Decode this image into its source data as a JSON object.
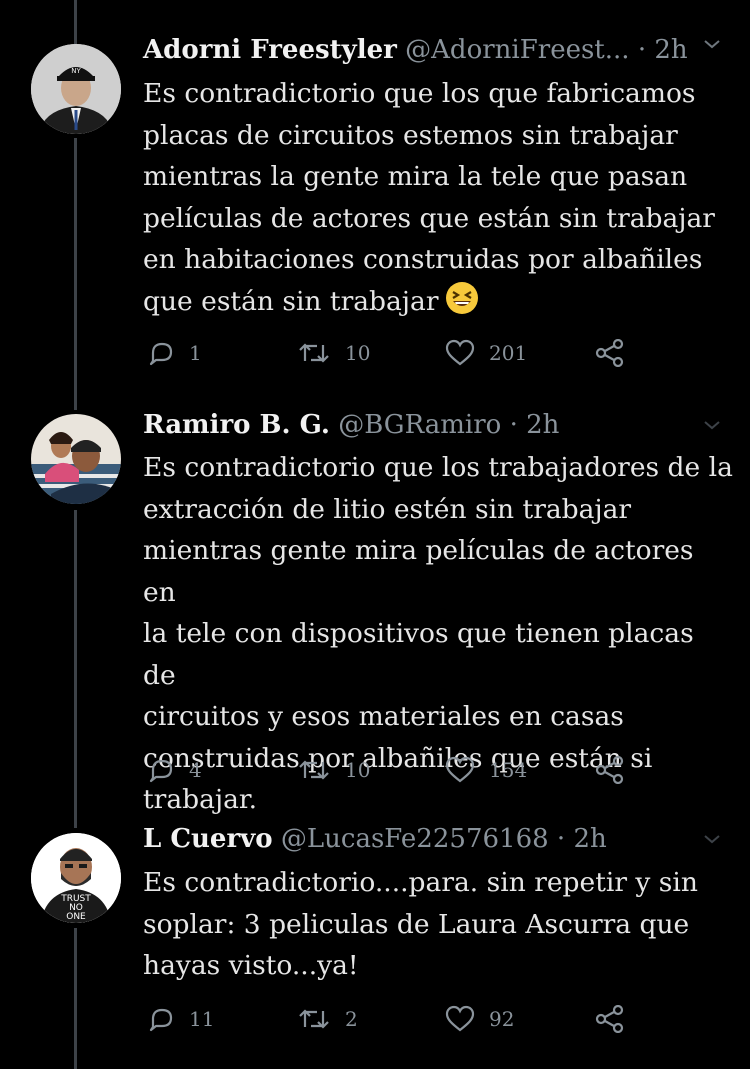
{
  "tweets": [
    {
      "name": "Adorni Freestyler",
      "handle": "@AdorniFreest...",
      "dot": "·",
      "time": "2h",
      "text": "Es contradictorio que los que fabricamos\nplacas de circuitos estemos sin trabajar\nmientras la gente mira la tele que pasan\npelículas de actores que están sin trabajar\nen habitaciones construidas por albañiles\nque están sin trabajar",
      "emoji": "grinning-squinting-face",
      "replies": "1",
      "retweets": "10",
      "likes": "201"
    },
    {
      "name": "Ramiro B. G.",
      "handle": "@BGRamiro",
      "dot": "·",
      "time": "2h",
      "text": "Es contradictorio que los trabajadores de la\nextracción de litio estén sin trabajar\nmientras gente mira películas de actores en\nla tele con dispositivos que tienen placas de\ncircuitos y esos materiales en casas\nconstruidas por albañiles que están si\ntrabajar.",
      "replies": "4",
      "retweets": "10",
      "likes": "154"
    },
    {
      "name": "L Cuervo",
      "handle": "@LucasFe22576168",
      "dot": "·",
      "time": "2h",
      "text": "Es contradictorio....para. sin repetir y sin\nsoplar: 3 peliculas de Laura Ascurra que\nhayas visto...ya!",
      "avatar_text": [
        "TRUST",
        "NO",
        "ONE"
      ],
      "replies": "11",
      "retweets": "2",
      "likes": "92"
    }
  ],
  "icons": [
    "reply-icon",
    "retweet-icon",
    "like-icon",
    "share-icon",
    "chevron-down-icon"
  ],
  "colors": {
    "background": "#000000",
    "text": "#e6e6e6",
    "secondary": "#8a939b",
    "thread_line": "#3d4248"
  }
}
